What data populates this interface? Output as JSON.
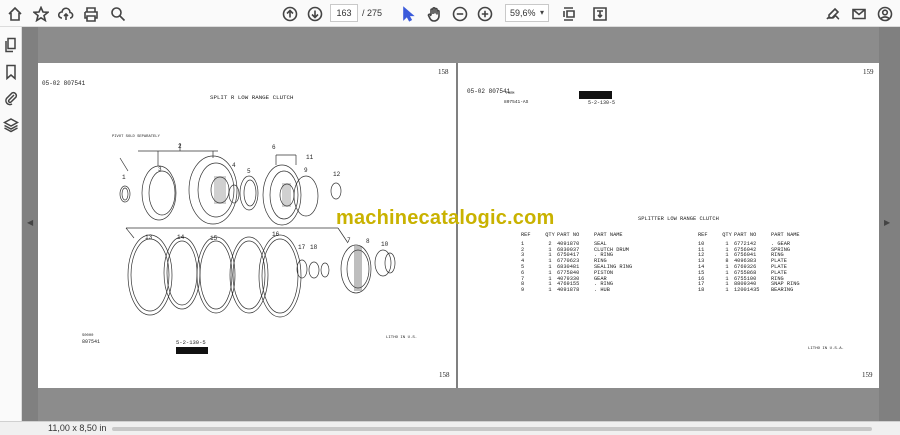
{
  "toolbar": {
    "page_current": "163",
    "page_total": "/ 275",
    "zoom": "59,6%"
  },
  "status": {
    "page_size": "11,00 x 8,50 in"
  },
  "left_page": {
    "header_left": "05-02   807541",
    "page_number": "158",
    "title": "SPLIT   R LOW RANGE CLUTCH",
    "sub_note": "PIVOT SOLD SEPARATELY",
    "callouts": [
      "1",
      "2",
      "3",
      "4",
      "5",
      "6",
      "7",
      "8",
      "9",
      "10",
      "11",
      "12",
      "13",
      "14",
      "15",
      "16",
      "17",
      "18"
    ],
    "footer_left_top": "S0000",
    "footer_left_bottom": "807541",
    "footer_code": "5-2-130-5",
    "footer_litho": "LITHO IN U.S.",
    "page_number_bottom": "158"
  },
  "right_page": {
    "header_left": "05-02   807541",
    "header_form": "FORM",
    "header_sub": "807541-AS",
    "header_code": "5-2-130-5",
    "page_number": "159",
    "table_title": "SPLITTER LOW RANGE CLUTCH",
    "columns": [
      "REF",
      "QTY",
      "PART NO",
      "PART NAME"
    ],
    "rows_left": [
      [
        "1",
        "2",
        "4091870",
        "SEAL"
      ],
      [
        "2",
        "1",
        "6830037",
        "CLUTCH DRUM"
      ],
      [
        "3",
        "1",
        "6750417",
        ". RING"
      ],
      [
        "4",
        "1",
        "6770623",
        "RING"
      ],
      [
        "5",
        "1",
        "6830481",
        "SEALING RING"
      ],
      [
        "6",
        "1",
        "6775840",
        "PISTON"
      ],
      [
        "7",
        "1",
        "4079330",
        "GEAR"
      ],
      [
        "8",
        "1",
        "4769155",
        ". RING"
      ],
      [
        "9",
        "1",
        "4091878",
        ". HUB"
      ]
    ],
    "rows_right": [
      [
        "10",
        "1",
        "6772142",
        ". GEAR"
      ],
      [
        "11",
        "1",
        "6756042",
        "SPRING"
      ],
      [
        "12",
        "1",
        "6756041",
        "RING"
      ],
      [
        "13",
        "8",
        "4096383",
        "PLATE"
      ],
      [
        "14",
        "1",
        "6769326",
        "PLATE"
      ],
      [
        "15",
        "1",
        "6755868",
        "PLATE"
      ],
      [
        "16",
        "1",
        "6755100",
        "RING"
      ],
      [
        "17",
        "1",
        "8809340",
        "SNAP RING"
      ],
      [
        "18",
        "1",
        "12001435",
        "BEARING"
      ]
    ],
    "footer_litho": "LITHO IN U.S.A.",
    "page_number_bottom": "159"
  },
  "watermark": "machinecatalogic.com"
}
